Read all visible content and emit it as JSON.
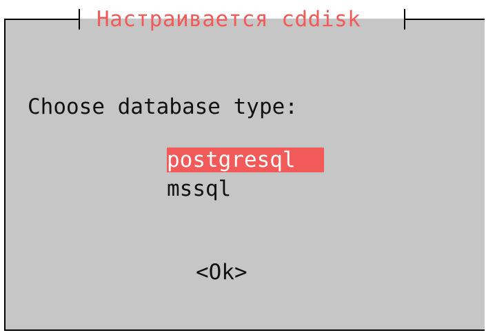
{
  "dialog": {
    "title": "Настраивается cddisk",
    "prompt": "Choose database type:",
    "options": [
      {
        "label": "postgresql",
        "selected": true
      },
      {
        "label": "mssql",
        "selected": false
      }
    ],
    "ok_label": "<Ok>"
  },
  "colors": {
    "dialog_background": "#c6c6c6",
    "accent": "#f25a5a",
    "text": "#111111"
  }
}
